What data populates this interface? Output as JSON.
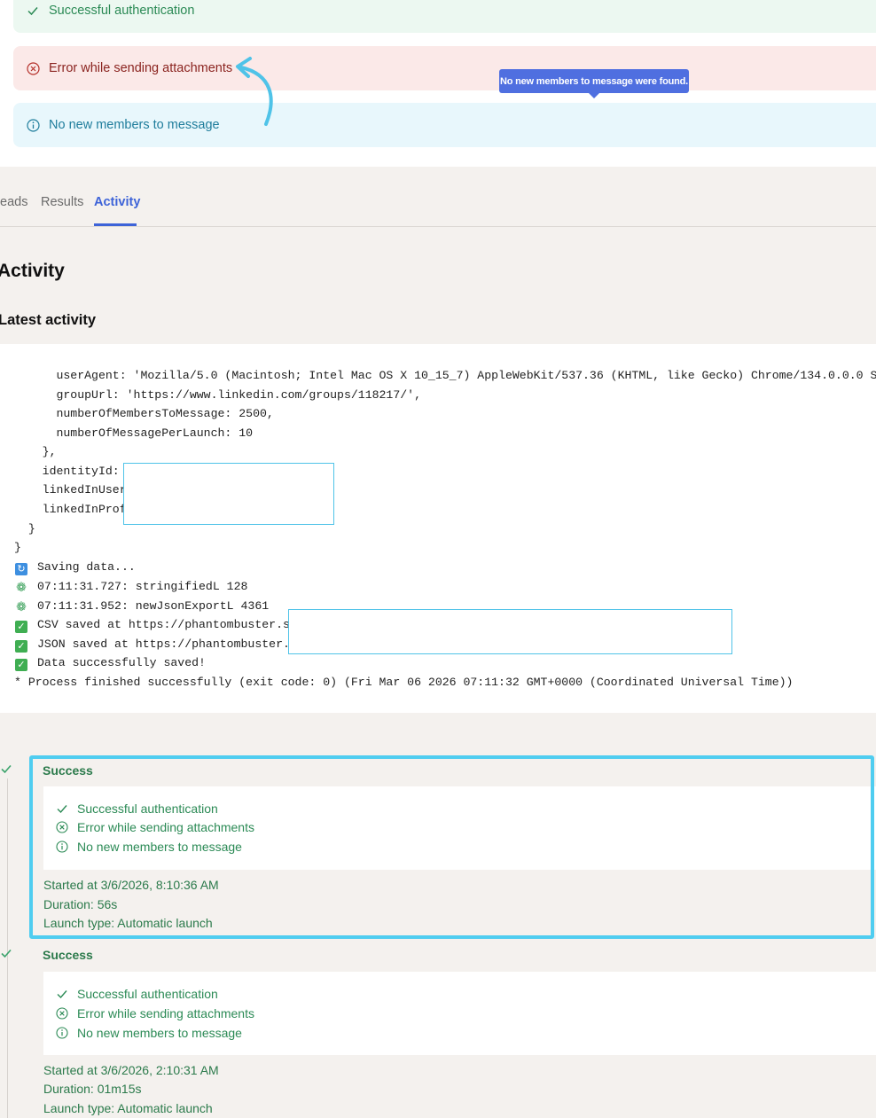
{
  "alerts": {
    "success": "Successful authentication",
    "error": "Error while sending attachments",
    "info": "No new members to message",
    "tooltip": "No new members to message were found."
  },
  "tabs": {
    "leads": "eads",
    "results": "Results",
    "activity": "Activity"
  },
  "section_title": "Activity",
  "sub_title": "Latest activity",
  "log": {
    "lines": [
      "      userAgent: 'Mozilla/5.0 (Macintosh; Intel Mac OS X 10_15_7) AppleWebKit/537.36 (KHTML, like Gecko) Chrome/134.0.0.0 S",
      "      groupUrl: 'https://www.linkedin.com/groups/118217/',",
      "      numberOfMembersToMessage: 2500,",
      "      numberOfMessagePerLaunch: 10",
      "    },",
      "    identityId:",
      "    linkedInUser",
      "    linkedInProf",
      "  }",
      "}"
    ],
    "saving": "Saving data...",
    "stringified": "07:11:31.727: stringifiedL 128",
    "newjson": "07:11:31.952: newJsonExportL 4361",
    "csv": "CSV saved at https://phantombuster.s",
    "json": "JSON saved at https://phantombuster.",
    "saved": "Data successfully saved!",
    "finished": "* Process finished successfully (exit code: 0) (Fri Mar 06 2026 07:11:32 GMT+0000 (Coordinated Universal Time))"
  },
  "runs": [
    {
      "status": "Success",
      "messages": [
        "Successful authentication",
        "Error while sending attachments",
        "No new members to message"
      ],
      "started": "Started at 3/6/2026, 8:10:36 AM",
      "duration": "Duration: 56s",
      "launch_type": "Launch type: Automatic launch"
    },
    {
      "status": "Success",
      "messages": [
        "Successful authentication",
        "Error while sending attachments",
        "No new members to message"
      ],
      "started": "Started at 3/6/2026, 2:10:31 AM",
      "duration": "Duration: 01m15s",
      "launch_type": "Launch type: Automatic launch"
    }
  ],
  "colors": {
    "accent": "#3d63d8",
    "success": "#2b8a55",
    "error": "#8b2420",
    "info": "#1f7d9c",
    "highlight": "#4fcdf0"
  }
}
